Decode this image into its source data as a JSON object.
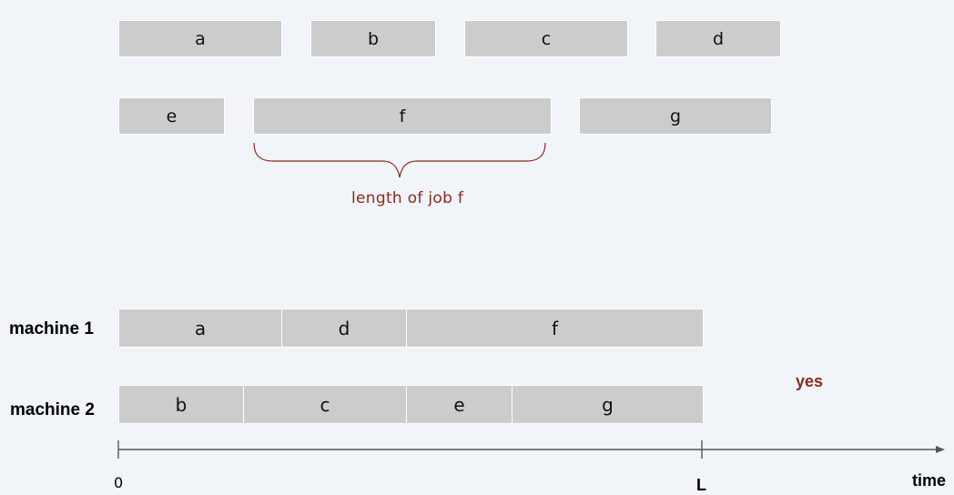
{
  "jobs": {
    "a": "a",
    "b": "b",
    "c": "c",
    "d": "d",
    "e": "e",
    "f": "f",
    "g": "g"
  },
  "annotation": "length of job f",
  "machines": {
    "m1": {
      "label": "machine 1",
      "jobs": [
        "a",
        "d",
        "f"
      ]
    },
    "m2": {
      "label": "machine 2",
      "jobs": [
        "b",
        "c",
        "e",
        "g"
      ]
    }
  },
  "answer": "yes",
  "axis": {
    "origin_label": "0",
    "deadline_label": "L",
    "axis_label": "time"
  },
  "colors": {
    "job_fill": "#cccccc",
    "accent": "#8b2a1c",
    "background": "#f1f5f9",
    "axis": "#555555"
  }
}
